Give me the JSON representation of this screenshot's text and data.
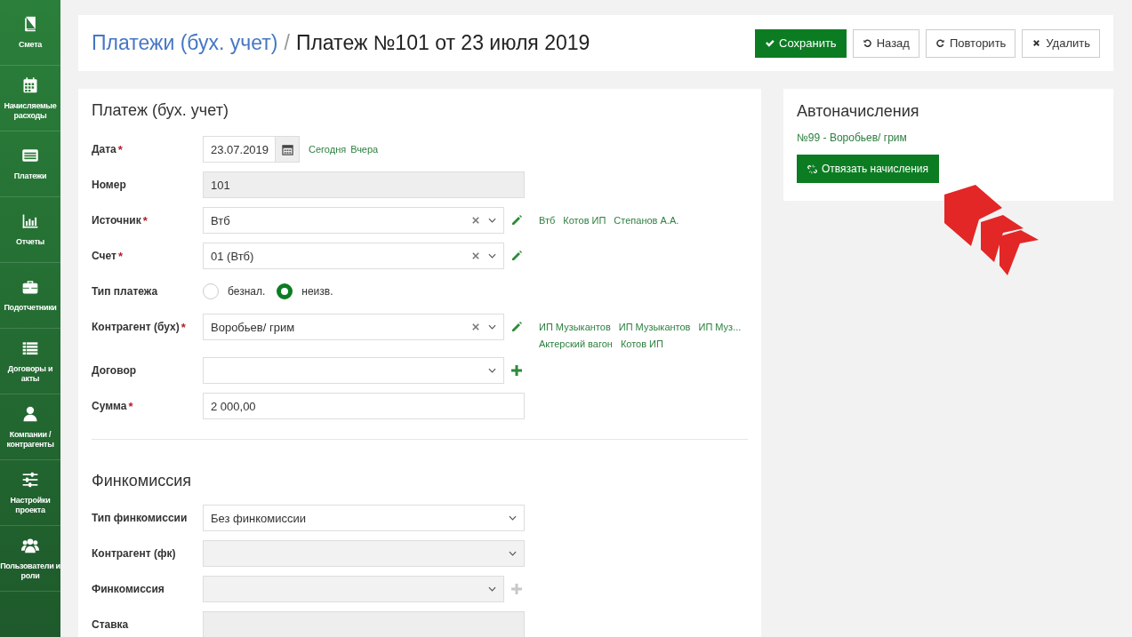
{
  "sidebar": {
    "items": [
      {
        "label": "Смета"
      },
      {
        "label": "Начисляемые расходы"
      },
      {
        "label": "Платежи"
      },
      {
        "label": "Отчеты"
      },
      {
        "label": "Подотчетники"
      },
      {
        "label": "Договоры и акты"
      },
      {
        "label": "Компании / контрагенты"
      },
      {
        "label": "Настройки проекта"
      },
      {
        "label": "Пользователи и роли"
      }
    ]
  },
  "header": {
    "breadcrumb": "Платежи (бух. учет)",
    "separator": "/",
    "title": "Платеж №101 от 23 июля 2019",
    "buttons": [
      {
        "label": "Сохранить",
        "kind": "primary"
      },
      {
        "label": "Назад",
        "kind": "default"
      },
      {
        "label": "Повторить",
        "kind": "default"
      },
      {
        "label": "Удалить",
        "kind": "default"
      }
    ]
  },
  "payment_form": {
    "title": "Платеж (бух. учет)",
    "fields": [
      {
        "kind": "date",
        "label": "Дата",
        "required_mark": "*",
        "value": "23.07.2019",
        "link_rows": [
          [
            "Сегодня",
            "Вчера"
          ]
        ]
      },
      {
        "kind": "text",
        "label": "Номер",
        "value": "101",
        "disabled": true
      },
      {
        "kind": "select",
        "label": "Источник",
        "required_mark": "*",
        "value": "Втб",
        "clearable": true,
        "editable": true,
        "link_rows": [
          [
            "Втб",
            "Котов ИП",
            "Степанов А.А."
          ]
        ]
      },
      {
        "kind": "select",
        "label": "Счет",
        "required_mark": "*",
        "value": "01 (Втб)",
        "clearable": true,
        "editable": true
      },
      {
        "kind": "radio",
        "label": "Тип платежа",
        "options": [
          {
            "label": "безнал.",
            "selected": false
          },
          {
            "label": "неизв.",
            "selected": true
          }
        ]
      },
      {
        "kind": "select",
        "label": "Контрагент (бух)",
        "required_mark": "*",
        "value": "Воробьев/ грим",
        "clearable": true,
        "editable": true,
        "link_rows": [
          [
            "ИП Музыкантов",
            "ИП Музыкантов",
            "ИП Муз..."
          ],
          [
            "Актерский вагон",
            "Котов ИП"
          ]
        ]
      },
      {
        "kind": "select",
        "label": "Договор",
        "addable": true
      },
      {
        "kind": "text",
        "label": "Сумма",
        "required_mark": "*",
        "value": "2 000,00"
      }
    ]
  },
  "commission_form": {
    "title": "Финкомиссия",
    "fields": [
      {
        "kind": "select",
        "label": "Тип финкомиссии",
        "value": "Без финкомиссии"
      },
      {
        "kind": "select",
        "label": "Контрагент (фк)",
        "disabled": true
      },
      {
        "kind": "select",
        "label": "Финкомиссия",
        "disabled": true,
        "addable": true
      },
      {
        "kind": "text",
        "label": "Ставка",
        "disabled": true
      }
    ]
  },
  "auto_charges": {
    "title": "Автоначисления",
    "link": "№99 - Воробьев/ грим",
    "button": {
      "label": "Отвязать начисления"
    }
  }
}
